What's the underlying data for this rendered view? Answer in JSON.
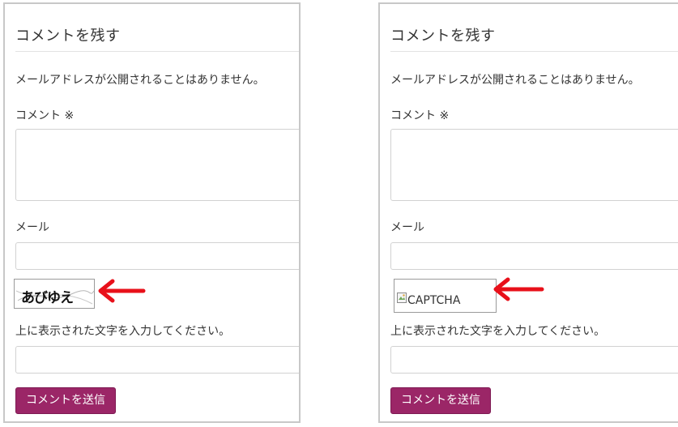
{
  "left": {
    "heading": "コメントを残す",
    "notice": "メールアドレスが公開されることはありません。",
    "comment_label": "コメント ※",
    "mail_label": "メール",
    "captcha_text": "あびゆえ",
    "instruction": "上に表示された文字を入力してください。",
    "submit_label": "コメントを送信"
  },
  "right": {
    "heading": "コメントを残す",
    "notice": "メールアドレスが公開されることはありません。",
    "comment_label": "コメント ※",
    "mail_label": "メール",
    "captcha_alt": "CAPTCHA",
    "instruction": "上に表示された文字を入力してください。",
    "submit_label": "コメントを送信"
  },
  "colors": {
    "button": "#9b2667",
    "arrow": "#e8101a",
    "border": "#c8c8c8"
  },
  "icons": {
    "arrow": "left-arrow-icon",
    "broken_image": "broken-image-icon"
  }
}
